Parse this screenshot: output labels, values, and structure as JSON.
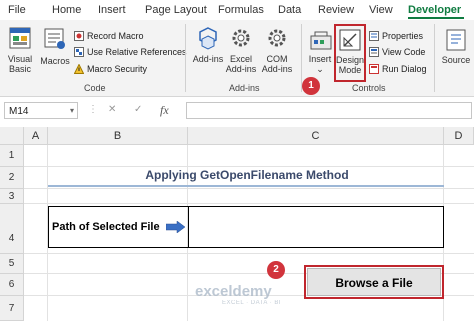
{
  "tabs": [
    "File",
    "Home",
    "Insert",
    "Page Layout",
    "Formulas",
    "Data",
    "Review",
    "View",
    "Developer"
  ],
  "active_tab": "Developer",
  "ribbon": {
    "code": {
      "visual_basic": "Visual Basic",
      "macros": "Macros",
      "record_macro": "Record Macro",
      "use_relative_references": "Use Relative References",
      "macro_security": "Macro Security",
      "group_label": "Code"
    },
    "addins": {
      "addins": "Add-ins",
      "excel_addins": "Excel Add-ins",
      "com_addins": "COM Add-ins",
      "group_label": "Add-ins"
    },
    "controls": {
      "insert": "Insert",
      "design_mode": "Design Mode",
      "properties": "Properties",
      "view_code": "View Code",
      "run_dialog": "Run Dialog",
      "group_label": "Controls"
    },
    "source": "Source"
  },
  "formula_bar": {
    "name_box": "M14",
    "cancel_symbol": "✕",
    "enter_symbol": "✓",
    "fx_symbol": "fx",
    "formula_value": ""
  },
  "grid": {
    "columns": [
      "A",
      "B",
      "C",
      "D"
    ],
    "rows": [
      "1",
      "2",
      "3",
      "4",
      "5",
      "6",
      "7"
    ]
  },
  "sheet": {
    "title": "Applying GetOpenFilename Method",
    "table_label": "Path of Selected File",
    "table_value": "",
    "button_label": "Browse a File"
  },
  "callouts": [
    "1",
    "2"
  ],
  "watermark": {
    "name": "exceldemy",
    "tagline": "EXCEL · DATA · BI"
  },
  "colors": {
    "accent_green": "#107c41",
    "highlight_red": "#c0262d",
    "badge_red": "#d1343c",
    "title_blue": "#3b4a6b",
    "arrow_blue": "#3a6fc4"
  }
}
